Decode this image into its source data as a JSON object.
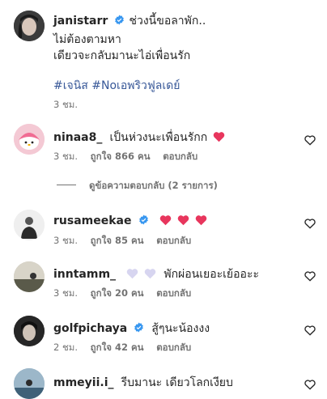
{
  "post": {
    "username": "janistarr",
    "caption_line1": "ช่วงนี้ขอลาพัก..",
    "caption_line2": "ไม่ต้องตามหา",
    "caption_line3": "เดียวจะกลับมานะไอ่เพื่อนรัก",
    "hashtags": "#เจนิส #Noเอพริวฟูลเดย์",
    "time": "3 ชม."
  },
  "comments": [
    {
      "username": "ninaa8_",
      "text": "เป็นห่วงนะเพื่อนรักก",
      "time": "3 ชม.",
      "likes": "ถูกใจ 866 คน",
      "reply": "ตอบกลับ",
      "verified": false
    },
    {
      "username": "rusameekae",
      "text": "",
      "time": "3 ชม.",
      "likes": "ถูกใจ 85 คน",
      "reply": "ตอบกลับ",
      "verified": true
    },
    {
      "username": "inntamm_",
      "text": "พักผ่อนเยอะเย้ออะะ",
      "time": "3 ชม.",
      "likes": "ถูกใจ 20 คน",
      "reply": "ตอบกลับ",
      "verified": false
    },
    {
      "username": "golfpichaya",
      "text": "สู้ๆนะน้องงง",
      "time": "2 ชม.",
      "likes": "ถูกใจ 42 คน",
      "reply": "ตอบกลับ",
      "verified": true
    },
    {
      "username": "mmeyii.i_",
      "text": "รีบมานะ เดียวโลกเงียบ",
      "time": "",
      "likes": "",
      "reply": "",
      "verified": false
    }
  ],
  "view_replies": "ดูข้อความตอบกลับ (2 รายการ)",
  "colors": {
    "verified": "#3897f0",
    "heart_red": "#e8365d",
    "heart_pale": "#d7d5f0",
    "meta": "#737373"
  }
}
